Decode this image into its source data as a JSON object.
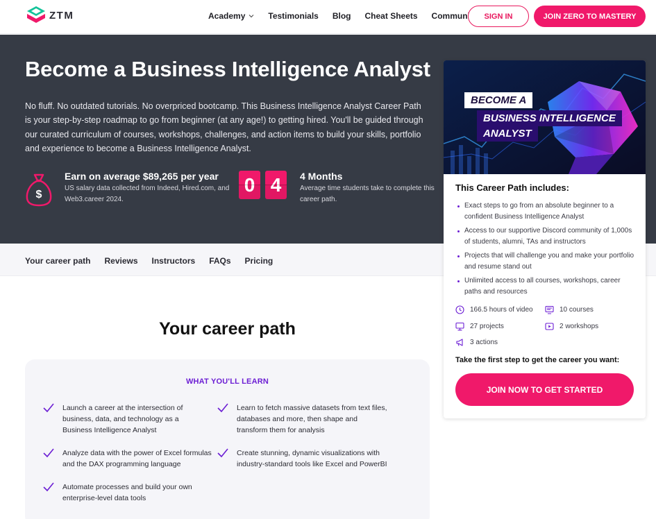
{
  "brand": {
    "name": "ZTM"
  },
  "nav": {
    "items": [
      "Academy",
      "Testimonials",
      "Blog",
      "Cheat Sheets",
      "Community"
    ],
    "sign_in": "SIGN IN",
    "join": "JOIN ZERO TO MASTERY"
  },
  "hero": {
    "title": "Become a Business Intelligence Analyst",
    "description": "No fluff. No outdated tutorials. No overpriced bootcamp. This Business Intelligence Analyst Career Path is your step-by-step roadmap to go from beginner (at any age!) to getting hired. You'll be guided through our curated curriculum of courses, workshops, challenges, and action items to build your skills, portfolio and experience to become a Business Intelligence Analyst.",
    "salary": {
      "title": "Earn on average $89,265 per year",
      "sub": "US salary data collected from Indeed, Hired.com, and Web3.career 2024."
    },
    "duration": {
      "digits": [
        "0",
        "4"
      ],
      "title": "4 Months",
      "sub": "Average time students take to complete this career path."
    }
  },
  "subnav": [
    "Your career path",
    "Reviews",
    "Instructors",
    "FAQs",
    "Pricing"
  ],
  "section": {
    "title": "Your career path",
    "learn_heading": "WHAT YOU'LL LEARN",
    "learn_items": [
      "Launch a career at the intersection of business, data, and technology as a Business Intelligence Analyst",
      "Learn to fetch massive datasets from text files, databases and more, then shape and transform them for analysis",
      "Analyze data with the power of Excel formulas and the DAX programming language",
      "Create stunning, dynamic visualizations with industry-standard tools like Excel and PowerBI",
      "Automate processes and build your own enterprise-level data tools"
    ]
  },
  "card": {
    "image_lines": [
      "BECOME A",
      "BUSINESS INTELLIGENCE",
      "ANALYST"
    ],
    "heading": "This Career Path includes:",
    "includes": [
      "Exact steps to go from an absolute beginner to a confident Business Intelligence Analyst",
      "Access to our supportive Discord community of 1,000s of students, alumni, TAs and instructors",
      "Projects that will challenge you and make your portfolio and resume stand out",
      "Unlimited access to all courses, workshops, career paths and resources"
    ],
    "features": [
      {
        "icon": "clock-icon",
        "text": "166.5 hours of video"
      },
      {
        "icon": "courses-icon",
        "text": "10 courses"
      },
      {
        "icon": "monitor-icon",
        "text": "27 projects"
      },
      {
        "icon": "play-icon",
        "text": "2 workshops"
      },
      {
        "icon": "megaphone-icon",
        "text": "3 actions"
      }
    ],
    "cta_text": "Take the first step to get the career you want:",
    "cta_button": "JOIN NOW TO GET STARTED"
  },
  "colors": {
    "accent": "#f0196a",
    "hero_bg": "#363b45",
    "purple": "#6c1ed4"
  }
}
